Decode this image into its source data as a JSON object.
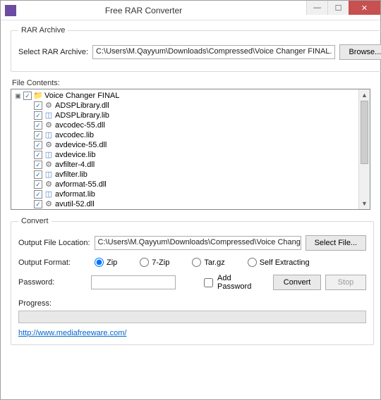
{
  "window": {
    "title": "Free RAR Converter"
  },
  "rar_archive": {
    "legend": "RAR Archive",
    "label": "Select RAR Archive:",
    "path": "C:\\Users\\M.Qayyum\\Downloads\\Compressed\\Voice Changer FINAL.",
    "browse": "Browse..."
  },
  "file_contents": {
    "label": "File Contents:",
    "root": "Voice Changer FINAL",
    "items": [
      {
        "name": "ADSPLibrary.dll",
        "type": "dll"
      },
      {
        "name": "ADSPLibrary.lib",
        "type": "lib"
      },
      {
        "name": "avcodec-55.dll",
        "type": "dll"
      },
      {
        "name": "avcodec.lib",
        "type": "lib"
      },
      {
        "name": "avdevice-55.dll",
        "type": "dll"
      },
      {
        "name": "avdevice.lib",
        "type": "lib"
      },
      {
        "name": "avfilter-4.dll",
        "type": "dll"
      },
      {
        "name": "avfilter.lib",
        "type": "lib"
      },
      {
        "name": "avformat-55.dll",
        "type": "dll"
      },
      {
        "name": "avformat.lib",
        "type": "lib"
      },
      {
        "name": "avutil-52.dll",
        "type": "dll"
      }
    ]
  },
  "convert": {
    "legend": "Convert",
    "output_label": "Output File Location:",
    "output_path": "C:\\Users\\M.Qayyum\\Downloads\\Compressed\\Voice Changer FII",
    "select_file": "Select File...",
    "format_label": "Output Format:",
    "formats": {
      "zip": "Zip",
      "seven_zip": "7-Zip",
      "targz": "Tar.gz",
      "sfx": "Self Extracting"
    },
    "password_label": "Password:",
    "add_password": "Add Password",
    "convert_btn": "Convert",
    "stop_btn": "Stop",
    "progress_label": "Progress:"
  },
  "link": {
    "text": "http://www.mediafreeware.com/"
  }
}
